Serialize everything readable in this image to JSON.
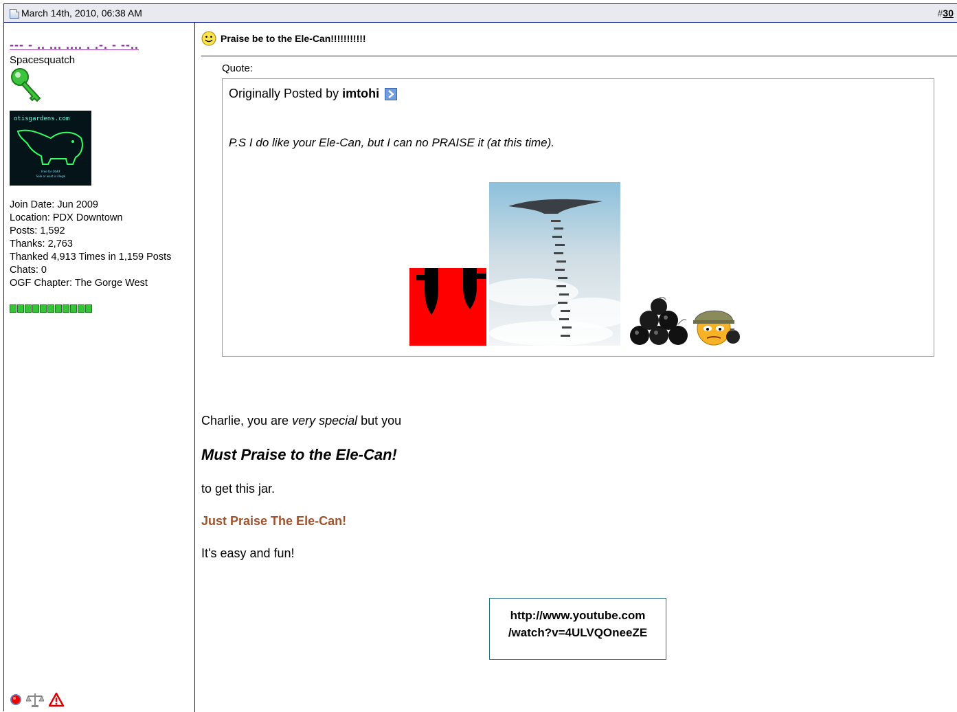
{
  "header": {
    "date": "March 14th, 2010, 06:38 AM",
    "post_number_prefix": "#",
    "post_number": "30"
  },
  "user": {
    "name": "--- - .. ... .... . .-. - --..",
    "title": "Spacesquatch",
    "info": {
      "join_date": "Join Date: Jun 2009",
      "location": "Location: PDX Downtown",
      "posts": "Posts: 1,592",
      "thanks": "Thanks: 2,763",
      "thanked": "Thanked 4,913 Times in 1,159 Posts",
      "chats": "Chats: 0",
      "chapter": "OGF Chapter: The Gorge West"
    },
    "reputation_blocks": 11,
    "avatar_site_text": "otisgardens.com",
    "avatar_caption": "Free for OGRF\nSale or want is illegal",
    "icons": [
      "offline-icon",
      "reputation-scales-icon",
      "report-post-icon"
    ]
  },
  "post": {
    "title": "Praise be to the Ele-Can!!!!!!!!!!!",
    "quote_label": "Quote:",
    "quote_origin_prefix": "Originally Posted by",
    "quote_author": "imtohi",
    "quote_text": "P.S I do like your Ele-Can, but I can no PRAISE it (at this time).",
    "line1_start": "Charlie, you are ",
    "line1_italic": "very special",
    "line1_end": " but you",
    "line2": "Must Praise to the Ele-Can!",
    "line3": "to get this jar.",
    "line4": "Just Praise The Ele-Can!",
    "line5": "It's easy and fun!",
    "link_line1": "http://www.youtube.com",
    "link_line2": "/watch?v=4ULVQOneeZE"
  },
  "colors": {
    "border": "#0b198c",
    "username": "#8a2b9e",
    "highlight_text": "#a0522d",
    "header_bg": "#e8eaf0"
  }
}
